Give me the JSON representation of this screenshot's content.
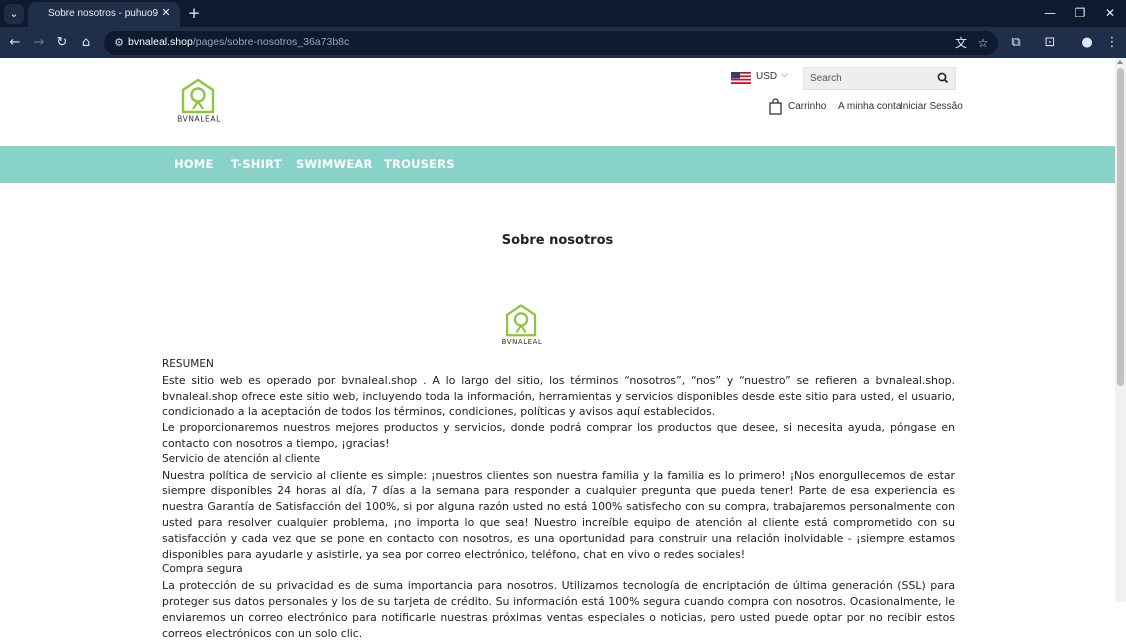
{
  "browser": {
    "tab_title": "Sobre nosotros - puhuo9",
    "url_host": "bvnaleal.shop",
    "url_path": "/pages/sobre-nosotros_36a73b8c"
  },
  "site": {
    "brand": "BVNALEAL",
    "currency": "USD",
    "search_placeholder": "Search",
    "cart_label": "Carrinho",
    "account_label": "A minha conta",
    "login_label": "Iniciar Sessão",
    "brand_color": "#8cc63f",
    "nav_color": "#88d2ca"
  },
  "nav": {
    "items": [
      "HOME",
      "T-SHIRT",
      "SWIMWEAR",
      "TROUSERS"
    ]
  },
  "page": {
    "title": "Sobre nosotros",
    "sections": [
      {
        "kind": "heading",
        "text": "RESUMEN"
      },
      {
        "kind": "paragraph",
        "text": "Este sitio web es operado por bvnaleal.shop . A lo largo del sitio, los términos “nosotros”, “nos” y “nuestro” se refieren a bvnaleal.shop. bvnaleal.shop ofrece este sitio web, incluyendo toda la información, herramientas y servicios disponibles desde este sitio para usted, el usuario, condicionado a la aceptación de todos los términos, condiciones, políticas y avisos aquí establecidos."
      },
      {
        "kind": "paragraph",
        "text": "Le proporcionaremos nuestros mejores productos y servicios, donde podrá comprar los productos que desee, si necesita ayuda, póngase en contacto con nosotros a tiempo, ¡gracias!"
      },
      {
        "kind": "heading",
        "text": "Servicio de atención al cliente"
      },
      {
        "kind": "paragraph",
        "text": "Nuestra política de servicio al cliente es simple: ¡nuestros clientes son nuestra familia y la familia es lo primero! ¡Nos enorgullecemos de estar siempre disponibles 24 horas al día, 7 días a la semana para responder a cualquier pregunta que pueda tener! Parte de esa experiencia es nuestra Garantía de Satisfacción del 100%, si por alguna razón usted no está 100% satisfecho con su compra, trabajaremos personalmente con usted para resolver cualquier problema, ¡no importa lo que sea! Nuestro increíble equipo de atención al cliente está comprometido con su satisfacción y cada vez que se pone en contacto con nosotros, es una oportunidad para construir una relación inolvidable - ¡siempre estamos disponibles para ayudarle y asistirle, ya sea por correo electrónico, teléfono, chat en vivo o redes sociales!"
      },
      {
        "kind": "heading",
        "text": "Compra segura"
      },
      {
        "kind": "paragraph",
        "text": "La protección de su privacidad es de suma importancia para nosotros. Utilizamos tecnología de encriptación de última generación (SSL) para proteger sus datos personales y los de su tarjeta de crédito. Su información está 100% segura cuando compra con nosotros. Ocasionalmente, le enviaremos un correo electrónico para notificarle nuestras próximas ventas especiales o noticias, pero usted puede optar por no recibir estos correos electrónicos con un solo clic."
      }
    ]
  }
}
